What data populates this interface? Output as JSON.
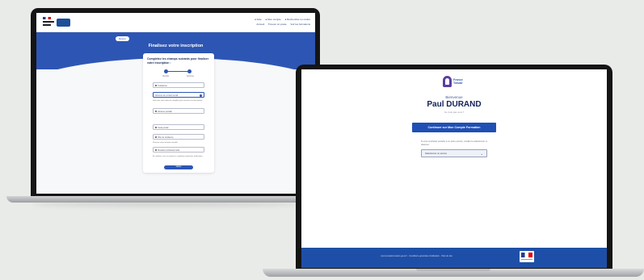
{
  "left_screen": {
    "header": {
      "nav_links": [
        "● Aide",
        "● Mon compte",
        "● Rechercher un métier",
        "Accueil",
        "Trouver un poste",
        "Voir les formations"
      ]
    },
    "banner": {
      "back_label": "Retour",
      "title": "Finalisez votre inscription"
    },
    "card": {
      "title": "Complétez les champs suivants pour finaliser votre inscription :",
      "steps": [
        "Identité",
        "Adresse"
      ],
      "fields": [
        {
          "label": "Téléphone",
          "selected": false
        },
        {
          "label": "Adresse de contact email",
          "selected": true
        },
        {
          "label": "Adresse postale",
          "selected": false
        },
        {
          "label": "Code postal",
          "selected": false
        },
        {
          "label": "Ville de résidence",
          "selected": false
        },
        {
          "label": "Situation professionnelle",
          "selected": false
        }
      ],
      "notes": [
        "Saisissez votre adresse complète pour recevoir vos documents.",
        "Précisez votre situation actuelle.",
        "En validant, vous acceptez les conditions générales d'utilisation."
      ],
      "submit_label": "Valider"
    }
  },
  "right_screen": {
    "logo_text": [
      "France",
      "Travail"
    ],
    "welcome": "Bienvenue",
    "name": "Paul DURAND",
    "subtitle": "Ce n'est pas vous ?",
    "cta_label": "Continuer sur Mon Compte Formation",
    "description": "Si vous souhaitez accéder à un autre service, veuillez le sélectionner ci-dessous :",
    "select": {
      "value": "Sélectionner un service"
    },
    "footer": {
      "text": "moncompteformation.gouv.fr · Conditions générales d'utilisation · Plan du site"
    }
  }
}
